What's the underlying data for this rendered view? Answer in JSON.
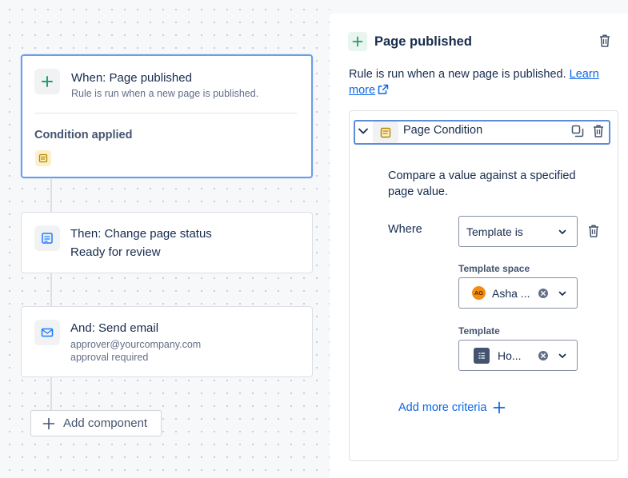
{
  "canvas": {
    "trigger_card": {
      "title": "When: Page published",
      "subtitle": "Rule is run when a new page is published.",
      "condition_label": "Condition applied",
      "icon": "plus-icon"
    },
    "action_card": {
      "title": "Then: Change page status",
      "detail": "Ready for review",
      "icon": "page-icon"
    },
    "email_card": {
      "title": "And: Send email",
      "line1": "approver@yourcompany.com",
      "line2": "approval required",
      "icon": "mail-icon"
    },
    "add_component_label": "Add component"
  },
  "panel": {
    "title": "Page published",
    "description": "Rule is run when a new page is published. ",
    "learn_more": "Learn more",
    "condition": {
      "title": "Page Condition",
      "description": "Compare a value against a specified page value.",
      "where_label": "Where",
      "operator_value": "Template is",
      "template_space_label": "Template space",
      "template_space_avatar": "AG",
      "template_space_value": "Asha ...",
      "template_label": "Template",
      "template_value": "Ho...",
      "add_more_label": "Add more criteria"
    }
  },
  "colors": {
    "accent": "#0c66e4",
    "selected_border": "#6b9ee8",
    "trigger_green": "#22a06b",
    "condition_yellow": "#b38600",
    "avatar_orange": "#f18d13"
  }
}
